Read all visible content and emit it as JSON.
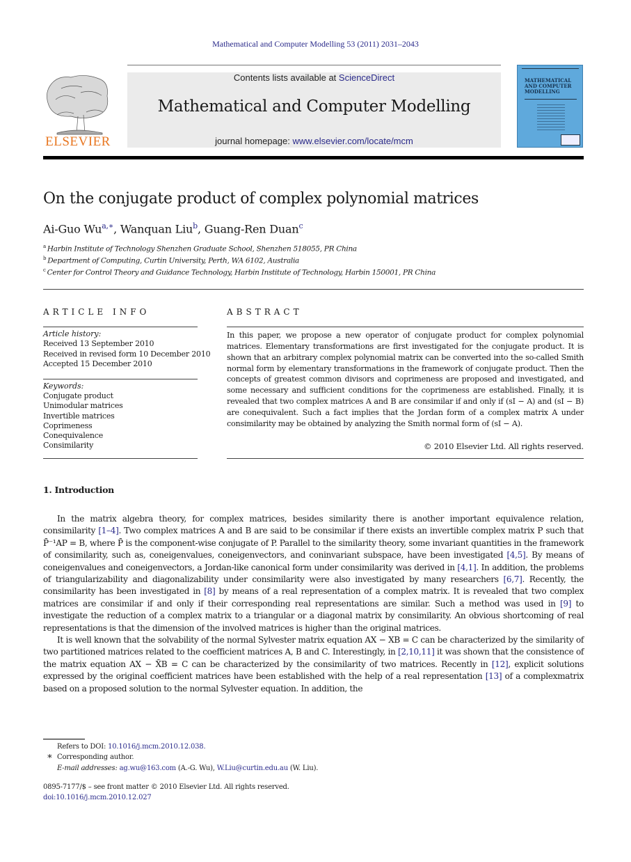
{
  "running_head": "Mathematical and Computer Modelling 53 (2011) 2031–2043",
  "masthead": {
    "publisher_logo": "ELSEVIER",
    "contents_prefix": "Contents lists available at ",
    "contents_link": "ScienceDirect",
    "journal_title": "Mathematical and Computer Modelling",
    "homepage_prefix": "journal homepage: ",
    "homepage_link": "www.elsevier.com/locate/mcm",
    "cover_title": "MATHEMATICAL AND COMPUTER MODELLING",
    "colors": {
      "publisher_orange": "#e87722",
      "link_blue": "#2a2a8a",
      "band_gray": "#ebebeb",
      "cover_blue": "#5fa9dc"
    }
  },
  "article": {
    "title": "On the conjugate product of complex polynomial matrices",
    "authors": [
      {
        "name": "Ai-Guo Wu",
        "marks": "a,∗"
      },
      {
        "name": "Wanquan Liu",
        "marks": "b"
      },
      {
        "name": "Guang-Ren Duan",
        "marks": "c"
      }
    ],
    "affiliations": [
      {
        "mark": "a",
        "text": "Harbin Institute of Technology Shenzhen Graduate School, Shenzhen 518055, PR China"
      },
      {
        "mark": "b",
        "text": "Department of Computing, Curtin University, Perth, WA 6102, Australia"
      },
      {
        "mark": "c",
        "text": "Center for Control Theory and Guidance Technology, Harbin Institute of Technology, Harbin 150001, PR China"
      }
    ]
  },
  "article_info": {
    "heading": "ARTICLE INFO",
    "history_label": "Article history:",
    "history": [
      "Received 13 September 2010",
      "Received in revised form 10 December 2010",
      "Accepted 15 December 2010"
    ],
    "keywords_label": "Keywords:",
    "keywords": [
      "Conjugate product",
      "Unimodular matrices",
      "Invertible matrices",
      "Coprimeness",
      "Conequivalence",
      "Consimilarity"
    ]
  },
  "abstract": {
    "heading": "ABSTRACT",
    "text": "In this paper, we propose a new operator of conjugate product for complex polynomial matrices. Elementary transformations are first investigated for the conjugate product. It is shown that an arbitrary complex polynomial matrix can be converted into the so-called Smith normal form by elementary transformations in the framework of conjugate product. Then the concepts of greatest common divisors and coprimeness are proposed and investigated, and some necessary and sufficient conditions for the coprimeness are established. Finally, it is revealed that two complex matrices A and B are consimilar if and only if (sI − A) and (sI − B) are conequivalent. Such a fact implies that the Jordan form of a complex matrix A under consimilarity may be obtained by analyzing the Smith normal form of (sI − A).",
    "copyright": "© 2010 Elsevier Ltd. All rights reserved."
  },
  "introduction": {
    "heading": "1.  Introduction",
    "p1": [
      "In the matrix algebra theory, for complex matrices, besides similarity there is another important equivalence relation, consimilarity ",
      "[1–4]",
      ". Two complex matrices A and B are said to be consimilar if there exists an invertible complex matrix P such that P̄⁻¹AP = B, where P̄ is the component-wise conjugate of P. Parallel to the similarity theory, some invariant quantities in the framework of consimilarity, such as, coneigenvalues, coneigenvectors, and coninvariant subspace, have been investigated ",
      "[4,5]",
      ". By means of coneigenvalues and coneigenvectors, a Jordan-like canonical form under consimilarity was derived in ",
      "[4,1]",
      ". In addition, the problems of triangularizability and diagonalizability under consimilarity were also investigated by many researchers ",
      "[6,7]",
      ". Recently, the consimilarity has been investigated in ",
      "[8]",
      " by means of a real representation of a complex matrix. It is revealed that two complex matrices are consimilar if and only if their corresponding real representations are similar. Such a method was used in ",
      "[9]",
      " to investigate the reduction of a complex matrix to a triangular or a diagonal matrix by consimilarity. An obvious shortcoming of real representations is that the dimension of the involved matrices is higher than the original matrices."
    ],
    "p2": [
      "It is well known that the solvability of the normal Sylvester matrix equation AX − XB = C can be characterized by the similarity of two partitioned matrices related to the coefficient matrices A, B and C. Interestingly, in ",
      "[2,10,11]",
      " it was shown that the consistence of the matrix equation AX − X̄B = C can be characterized by the consimilarity of two matrices. Recently in ",
      "[12]",
      ", explicit solutions expressed by the original coefficient matrices have been established with the help of a real representation ",
      "[13]",
      " of a complexmatrix based on a proposed solution to the normal Sylvester equation. In addition, the"
    ]
  },
  "footnotes": {
    "refers_prefix": "Refers to DOI: ",
    "refers_doi": "10.1016/j.mcm.2010.12.038.",
    "star": "∗",
    "corresponding": "Corresponding author.",
    "email_label": "E-mail addresses: ",
    "email1": "ag.wu@163.com",
    "email1_owner": " (A.-G. Wu), ",
    "email2": "W.Liu@curtin.edu.au",
    "email2_owner": " (W. Liu)."
  },
  "bottom": {
    "issn_line": "0895-7177/$ – see front matter © 2010 Elsevier Ltd. All rights reserved.",
    "doi": "doi:10.1016/j.mcm.2010.12.027"
  }
}
